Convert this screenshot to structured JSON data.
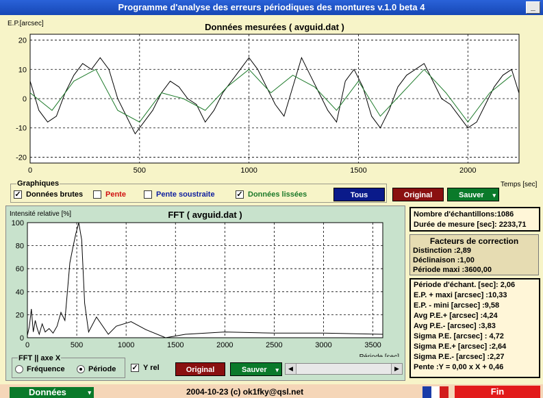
{
  "window": {
    "title": "Programme d'analyse des erreurs périodiques des montures v.1.0 beta 4",
    "minimize_glyph": "_"
  },
  "top_chart": {
    "title": "Données mesurées ( avguid.dat )",
    "ylabel": "E.P.[arcsec]",
    "xlabel": "Temps [sec]",
    "xticks": [
      "0",
      "500",
      "1000",
      "1500",
      "2000"
    ],
    "yticks": [
      "20",
      "10",
      "0",
      "-10",
      "-20"
    ]
  },
  "graphiques": {
    "legend": "Graphiques",
    "donnees_brutes": "Données brutes",
    "pente": "Pente",
    "pente_soustraite": "Pente soustraite",
    "donnees_lissees": "Données lissées",
    "check_mark": "✓"
  },
  "buttons": {
    "tous": "Tous",
    "original": "Original",
    "sauver": "Sauver",
    "original2": "Original",
    "sauver2": "Sauver",
    "dropdown_glyph": "▾"
  },
  "fft_chart": {
    "title": "FFT ( avguid.dat )",
    "ylabel": "Intensité relative [%]",
    "xlabel": "Période [sec]",
    "xticks": [
      "0",
      "500",
      "1000",
      "1500",
      "2000",
      "2500",
      "3000",
      "3500"
    ],
    "yticks": [
      "100",
      "80",
      "60",
      "40",
      "20",
      "0"
    ]
  },
  "fft_axis": {
    "legend": "FFT || axe X",
    "frequence": "Fréquence",
    "periode": "Période",
    "yrel": "Y rel"
  },
  "stats": {
    "samples": "Nombre d'échantillons:1086",
    "duration": "Durée de mesure [sec]: 2233,71"
  },
  "correction": {
    "title": "Facteurs de correction",
    "distinction": "Distinction :2,89",
    "declinaison": "Déclinaison :1,00",
    "periode_maxi": "Période maxi :3600,00"
  },
  "results": {
    "periode_echant": "Période d'échant. [sec]: 2,06",
    "ep_plus": "E.P. + maxi [arcsec] :10,33",
    "ep_minus": "E.P. - mini [arcsec] :9,58",
    "avg_plus": "Avg P.E.+ [arcsec] :4,24",
    "avg_minus": "Avg P.E.- [arcsec] :3,83",
    "sigma": "Sigma P.E. [arcsec] : 4,72",
    "sigma_plus": "Sigma P.E.+ [arcsec] :2,64",
    "sigma_minus": "Sigma P.E.- [arcsec] :2,27",
    "pente": "Pente :Y = 0,00 x X + 0,46"
  },
  "footer": {
    "donnees": "Données",
    "credit": "2004-10-23 (c) ok1fky@qsl.net",
    "fin": "Fin"
  },
  "colors": {
    "raw": "#000000",
    "smoothed": "#1d7a2a",
    "tous": "#0a1a8a",
    "original": "#8a1010",
    "sauver": "#0a7a2a",
    "fin": "#e21a1a"
  },
  "chart_data": [
    {
      "type": "line",
      "title": "Données mesurées ( avguid.dat )",
      "xlabel": "Temps [sec]",
      "ylabel": "E.P.[arcsec]",
      "xlim": [
        0,
        2233.71
      ],
      "ylim": [
        -22,
        22
      ],
      "grid": true,
      "series": [
        {
          "name": "Données brutes",
          "x": [
            0,
            40,
            80,
            120,
            160,
            200,
            240,
            280,
            320,
            360,
            400,
            440,
            480,
            520,
            560,
            600,
            640,
            680,
            720,
            760,
            800,
            840,
            880,
            920,
            960,
            1000,
            1040,
            1080,
            1120,
            1160,
            1200,
            1240,
            1280,
            1320,
            1360,
            1400,
            1440,
            1480,
            1520,
            1560,
            1600,
            1640,
            1680,
            1720,
            1760,
            1800,
            1840,
            1880,
            1920,
            1960,
            2000,
            2040,
            2080,
            2120,
            2160,
            2200,
            2233
          ],
          "y": [
            6,
            -4,
            -8,
            -6,
            2,
            8,
            12,
            10,
            14,
            10,
            0,
            -6,
            -12,
            -8,
            -4,
            2,
            6,
            4,
            0,
            -2,
            -8,
            -4,
            2,
            6,
            10,
            14,
            10,
            4,
            -2,
            -6,
            4,
            14,
            8,
            2,
            -4,
            -8,
            6,
            10,
            4,
            -6,
            -10,
            -4,
            4,
            8,
            10,
            12,
            6,
            0,
            -2,
            -6,
            -10,
            -8,
            -2,
            4,
            8,
            10,
            2
          ]
        },
        {
          "name": "Données lissées",
          "x": [
            0,
            100,
            200,
            300,
            400,
            500,
            600,
            700,
            800,
            900,
            1000,
            1100,
            1200,
            1300,
            1400,
            1500,
            1600,
            1700,
            1800,
            1900,
            2000,
            2100,
            2200
          ],
          "y": [
            2,
            -4,
            6,
            10,
            -4,
            -8,
            2,
            0,
            -4,
            4,
            10,
            2,
            8,
            4,
            -4,
            6,
            -6,
            2,
            10,
            2,
            -8,
            2,
            8
          ]
        }
      ]
    },
    {
      "type": "line",
      "title": "FFT ( avguid.dat )",
      "xlabel": "Période [sec]",
      "ylabel": "Intensité relative [%]",
      "xlim": [
        0,
        3600
      ],
      "ylim": [
        0,
        100
      ],
      "grid": true,
      "series": [
        {
          "x": [
            0,
            20,
            40,
            60,
            80,
            100,
            120,
            150,
            180,
            220,
            260,
            300,
            340,
            380,
            400,
            430,
            460,
            490,
            520,
            550,
            580,
            620,
            700,
            820,
            900,
            1050,
            1200,
            1400,
            1600,
            2000,
            2500,
            3000,
            3600
          ],
          "y": [
            2,
            10,
            25,
            5,
            15,
            8,
            3,
            12,
            5,
            8,
            4,
            10,
            22,
            15,
            35,
            65,
            78,
            90,
            100,
            85,
            30,
            5,
            18,
            3,
            10,
            14,
            7,
            0,
            3,
            5,
            4,
            4,
            3
          ]
        }
      ]
    }
  ]
}
